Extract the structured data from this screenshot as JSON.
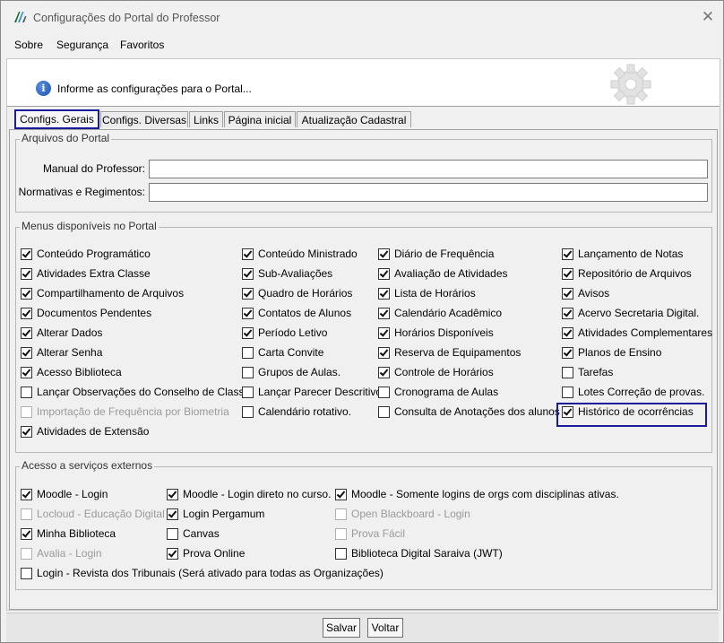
{
  "window": {
    "title": "Configurações do Portal do Professor",
    "close_glyph": "✕"
  },
  "menubar": [
    {
      "label": "Sobre"
    },
    {
      "label": "Segurança"
    },
    {
      "label": "Favoritos"
    }
  ],
  "banner": {
    "text": "Informe as configurações para o Portal...",
    "info_glyph": "i"
  },
  "tabs": [
    {
      "label": "Configs. Gerais",
      "active": true
    },
    {
      "label": "Configs. Diversas"
    },
    {
      "label": "Links"
    },
    {
      "label": "Página inicial"
    },
    {
      "label": "Atualização Cadastral"
    }
  ],
  "arquivos": {
    "title": "Arquivos do Portal",
    "manual_label": "Manual do Professor:",
    "manual_value": "",
    "normativas_label": "Normativas e Regimentos:",
    "normativas_value": ""
  },
  "menus": {
    "title": "Menus disponíveis no Portal",
    "columns": [
      [
        {
          "label": "Conteúdo Programático",
          "checked": true
        },
        {
          "label": "Atividades Extra Classe",
          "checked": true
        },
        {
          "label": "Compartilhamento de Arquivos",
          "checked": true
        },
        {
          "label": "Documentos Pendentes",
          "checked": true
        },
        {
          "label": "Alterar Dados",
          "checked": true
        },
        {
          "label": "Alterar Senha",
          "checked": true
        },
        {
          "label": "Acesso Biblioteca",
          "checked": true
        },
        {
          "label": "Lançar Observações do Conselho de Classe",
          "checked": false
        },
        {
          "label": "Importação de Frequência por Biometria",
          "checked": false,
          "disabled": true
        },
        {
          "label": "Atividades de Extensão",
          "checked": true
        }
      ],
      [
        {
          "label": "Conteúdo Ministrado",
          "checked": true
        },
        {
          "label": "Sub-Avaliações",
          "checked": true
        },
        {
          "label": "Quadro de Horários",
          "checked": true
        },
        {
          "label": "Contatos de Alunos",
          "checked": true
        },
        {
          "label": "Período Letivo",
          "checked": true
        },
        {
          "label": "Carta Convite",
          "checked": false
        },
        {
          "label": "Grupos de Aulas.",
          "checked": false
        },
        {
          "label": "Lançar Parecer Descritivo",
          "checked": false
        },
        {
          "label": "Calendário rotativo.",
          "checked": false
        }
      ],
      [
        {
          "label": "Diário de Frequência",
          "checked": true
        },
        {
          "label": "Avaliação de Atividades",
          "checked": true
        },
        {
          "label": "Lista de Horários",
          "checked": true
        },
        {
          "label": "Calendário Acadêmico",
          "checked": true
        },
        {
          "label": "Horários Disponíveis",
          "checked": true
        },
        {
          "label": "Reserva de Equipamentos",
          "checked": true
        },
        {
          "label": "Controle de Horários",
          "checked": true
        },
        {
          "label": "Cronograma de Aulas",
          "checked": false
        },
        {
          "label": "Consulta de Anotações dos alunos",
          "checked": false
        }
      ],
      [
        {
          "label": "Lançamento de Notas",
          "checked": true
        },
        {
          "label": "Repositório de Arquivos",
          "checked": true
        },
        {
          "label": "Avisos",
          "checked": true
        },
        {
          "label": "Acervo Secretaria Digital.",
          "checked": true
        },
        {
          "label": "Atividades Complementares",
          "checked": true
        },
        {
          "label": "Planos de Ensino",
          "checked": true
        },
        {
          "label": "Tarefas",
          "checked": false
        },
        {
          "label": "Lotes Correção de provas.",
          "checked": false
        },
        {
          "label": "Histórico de ocorrências",
          "checked": true,
          "highlight": true
        }
      ]
    ]
  },
  "externos": {
    "title": "Acesso a serviços externos",
    "columns": [
      [
        {
          "label": "Moodle - Login",
          "checked": true
        },
        {
          "label": "Locloud - Educação Digital",
          "checked": false,
          "disabled": true
        },
        {
          "label": "Minha Biblioteca",
          "checked": true
        },
        {
          "label": "Avalia - Login",
          "checked": false,
          "disabled": true
        },
        {
          "label": "Login - Revista dos Tribunais (Será ativado para todas as Organizações)",
          "checked": false
        }
      ],
      [
        {
          "label": "Moodle - Login direto no curso.",
          "checked": true
        },
        {
          "label": "Login Pergamum",
          "checked": true
        },
        {
          "label": "Canvas",
          "checked": false
        },
        {
          "label": "Prova Online",
          "checked": true
        }
      ],
      [
        {
          "label": "Moodle - Somente logins de orgs com disciplinas ativas.",
          "checked": true
        },
        {
          "label": "Open Blackboard - Login",
          "checked": false,
          "disabled": true
        },
        {
          "label": "Prova Fácil",
          "checked": false,
          "disabled": true
        },
        {
          "label": "Biblioteca Digital Saraiva (JWT)",
          "checked": false
        }
      ]
    ]
  },
  "footer": {
    "save_label": "Salvar",
    "back_label": "Voltar"
  },
  "colors": {
    "highlight": "#1a1a9c",
    "info_icon": "#1a4fb0"
  }
}
